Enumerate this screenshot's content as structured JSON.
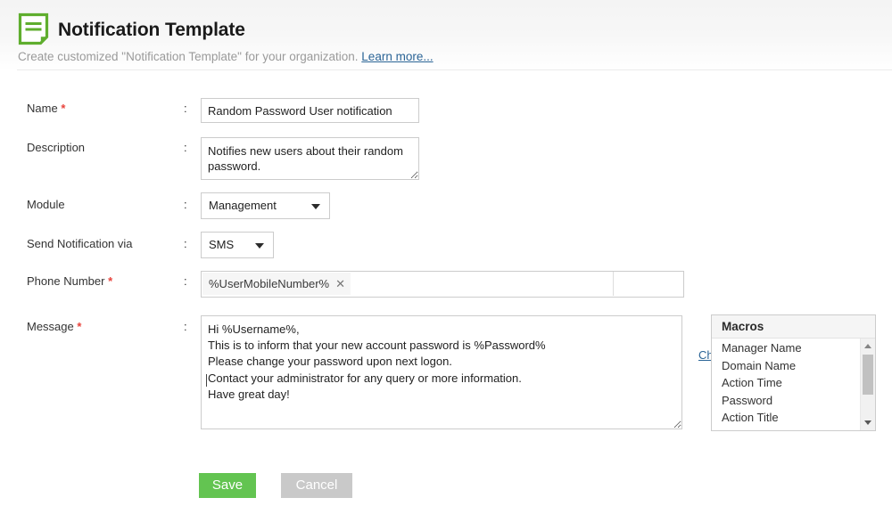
{
  "header": {
    "icon": "document-lines-icon",
    "title": "Notification Template",
    "subtitle_text": "Create customized \"Notification Template\" for your organization.",
    "learn_more_label": "Learn more...",
    "accent_green": "#5fae2e",
    "link_color": "#2a6496"
  },
  "form": {
    "colon": ":",
    "required_mark": "*",
    "fields": {
      "name": {
        "label": "Name",
        "required": true,
        "value": "Random Password User notification",
        "placeholder": ""
      },
      "description": {
        "label": "Description",
        "required": false,
        "value": "Notifies new users about their random password.",
        "placeholder": ""
      },
      "module": {
        "label": "Module",
        "required": false,
        "selected": "Management"
      },
      "send_via": {
        "label": "Send Notification via",
        "required": false,
        "selected": "SMS"
      },
      "phone_number": {
        "label": "Phone Number",
        "required": true,
        "token": "%UserMobileNumber%",
        "token_remove_icon": "close-icon",
        "choose_label": "Choose"
      },
      "message": {
        "label": "Message",
        "required": true,
        "value": "Hi %Username%,\nThis is to inform that your new account password is %Password%\nPlease change your password upon next logon.\nContact your administrator for any query or more information.\nHave great day!"
      }
    }
  },
  "macros": {
    "title": "Macros",
    "items": [
      "Manager Name",
      "Domain Name",
      "Action Time",
      "Password",
      "Action Title"
    ],
    "scroll_up_icon": "caret-up-icon",
    "scroll_down_icon": "caret-down-icon"
  },
  "actions": {
    "save_label": "Save",
    "cancel_label": "Cancel",
    "save_color": "#63c451",
    "cancel_color": "#c9c9c9"
  }
}
